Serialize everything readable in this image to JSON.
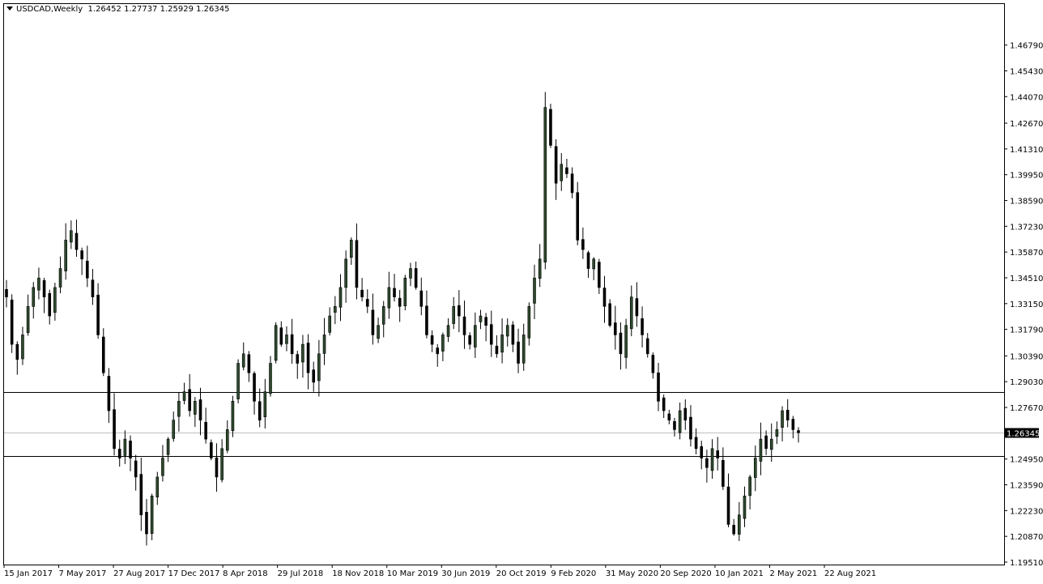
{
  "title": {
    "symbol": "USDCAD,Weekly",
    "ohlc": "1.26452 1.27737 1.25929 1.26345"
  },
  "current_price_label": "1.26345",
  "colors": {
    "background": "#ffffff",
    "frame": "#000000",
    "bull_fill": "#2e4a2e",
    "bear_fill": "#000000",
    "candle_outline": "#000000",
    "hline": "#000000",
    "current_line": "#c0c0c0",
    "price_label_bg": "#000000"
  },
  "chart_data": {
    "type": "candlestick",
    "title": "USDCAD,Weekly",
    "ylim": [
      1.1951,
      1.478
    ],
    "y_ticks": [
      "1.46790",
      "1.45430",
      "1.44070",
      "1.42670",
      "1.41310",
      "1.39950",
      "1.38590",
      "1.37230",
      "1.35870",
      "1.34510",
      "1.33150",
      "1.31790",
      "1.30390",
      "1.29030",
      "1.27670",
      "1.26345",
      "1.24950",
      "1.23590",
      "1.22230",
      "1.20870",
      "1.19510"
    ],
    "x_ticks": [
      "15 Jan 2017",
      "7 May 2017",
      "27 Aug 2017",
      "17 Dec 2017",
      "8 Apr 2018",
      "29 Jul 2018",
      "18 Nov 2018",
      "10 Mar 2019",
      "30 Jun 2019",
      "20 Oct 2019",
      "9 Feb 2020",
      "31 May 2020",
      "20 Sep 2020",
      "10 Jan 2021",
      "2 May 2021",
      "22 Aug 2021"
    ],
    "horizontal_lines": [
      1.285,
      1.251
    ],
    "current_price": 1.26345,
    "close_path": [
      1.335,
      1.31,
      1.302,
      1.315,
      1.33,
      1.34,
      1.345,
      1.335,
      1.325,
      1.34,
      1.35,
      1.365,
      1.37,
      1.36,
      1.355,
      1.345,
      1.335,
      1.315,
      1.295,
      1.275,
      1.255,
      1.25,
      1.26,
      1.25,
      1.24,
      1.22,
      1.21,
      1.23,
      1.24,
      1.25,
      1.26,
      1.27,
      1.28,
      1.285,
      1.275,
      1.28,
      1.27,
      1.26,
      1.25,
      1.24,
      1.255,
      1.265,
      1.28,
      1.3,
      1.305,
      1.295,
      1.28,
      1.27,
      1.285,
      1.3,
      1.32,
      1.31,
      1.315,
      1.305,
      1.3,
      1.31,
      1.295,
      1.29,
      1.305,
      1.315,
      1.325,
      1.33,
      1.34,
      1.355,
      1.365,
      1.34,
      1.335,
      1.33,
      1.315,
      1.32,
      1.33,
      1.34,
      1.335,
      1.33,
      1.345,
      1.35,
      1.34,
      1.33,
      1.315,
      1.31,
      1.305,
      1.315,
      1.32,
      1.33,
      1.325,
      1.315,
      1.31,
      1.32,
      1.325,
      1.32,
      1.31,
      1.305,
      1.315,
      1.32,
      1.31,
      1.3,
      1.315,
      1.33,
      1.345,
      1.355,
      1.435,
      1.415,
      1.395,
      1.405,
      1.4,
      1.39,
      1.365,
      1.36,
      1.35,
      1.355,
      1.34,
      1.33,
      1.32,
      1.315,
      1.305,
      1.32,
      1.335,
      1.325,
      1.315,
      1.305,
      1.295,
      1.28,
      1.275,
      1.27,
      1.265,
      1.275,
      1.27,
      1.26,
      1.255,
      1.25,
      1.245,
      1.255,
      1.25,
      1.235,
      1.215,
      1.21,
      1.22,
      1.23,
      1.24,
      1.25,
      1.26,
      1.255,
      1.26,
      1.265,
      1.275,
      1.27,
      1.265,
      1.2634
    ]
  }
}
